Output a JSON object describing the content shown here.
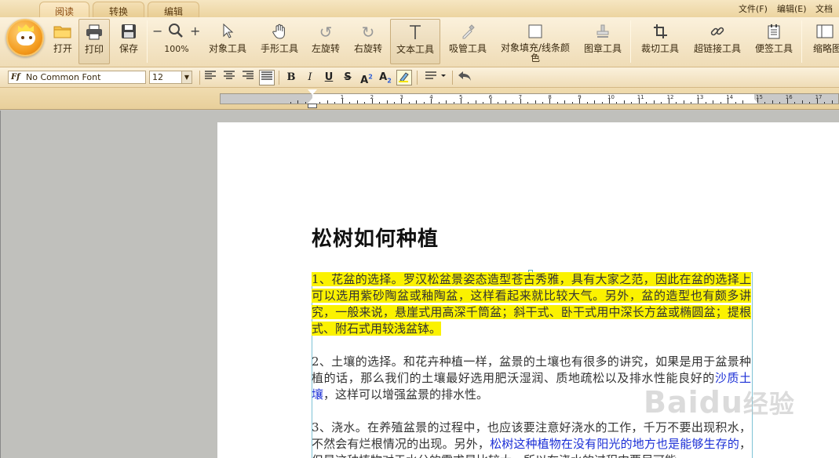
{
  "tabs": [
    {
      "label": "阅读",
      "active": true
    },
    {
      "label": "转换",
      "active": false
    },
    {
      "label": "编辑",
      "active": false
    }
  ],
  "menu": [
    "文件(F)",
    "编辑(E)",
    "文档"
  ],
  "ribbon": {
    "open": "打开",
    "print": "打印",
    "save": "保存",
    "zoom_level": "100%",
    "object_tool": "对象工具",
    "hand_tool": "手形工具",
    "rotate_left": "左旋转",
    "rotate_right": "右旋转",
    "text_tool": "文本工具",
    "eyedropper_tool": "吸管工具",
    "fill_color": "对象填充/线条颜色",
    "stamp_tool": "图章工具",
    "crop_tool": "裁切工具",
    "hyperlink_tool": "超链接工具",
    "note_tool": "便签工具",
    "thumbnail": "缩略图"
  },
  "format": {
    "font_name": "No Common Font",
    "font_size": "12",
    "bold": "B",
    "italic": "I",
    "underline": "U",
    "strikethrough": "S"
  },
  "ruler_numbers": [
    "1",
    "2",
    "3",
    "4",
    "5",
    "6",
    "7",
    "8",
    "9",
    "10",
    "11",
    "12",
    "13",
    "14",
    "15",
    "16",
    "17"
  ],
  "document": {
    "title": "松树如何种植",
    "p1": "1、花盆的选择。罗汉松盆景姿态造型苍古秀雅，具有大家之范，因此在盆的选择上可以选用紫砂陶盆或釉陶盆，这样看起来就比较大气。另外，盆的造型也有颇多讲究，一般来说，悬崖式用高深千筒盆；斜干式、卧干式用中深长方盆或椭圆盆；提根式、附石式用较浅盆钵。",
    "p2a": "2、土壤的选择。和花卉种植一样，盆景的土壤也有很多的讲究，如果是用于盆景种植的话，那么我们的土壤最好选用肥沃湿润、质地疏松以及排水性能良好的",
    "p2b": "沙质土壤",
    "p2c": "，这样可以增强盆景的排水性。",
    "p3a": "3、浇水。在养殖盆景的过程中，也应该要注意好浇水的工作，千万不要出现积水，不然会有烂根情况的出现。另外，",
    "p3b": "松树这种植物在没有阳光的地方也是能够生存的",
    "p3c": "，但是这种植物对于水分的需求是比较大，所以在浇水的过程中要尽可能"
  },
  "watermark": {
    "brand": "Bai",
    "suffix": "du",
    "cn": "经验"
  }
}
